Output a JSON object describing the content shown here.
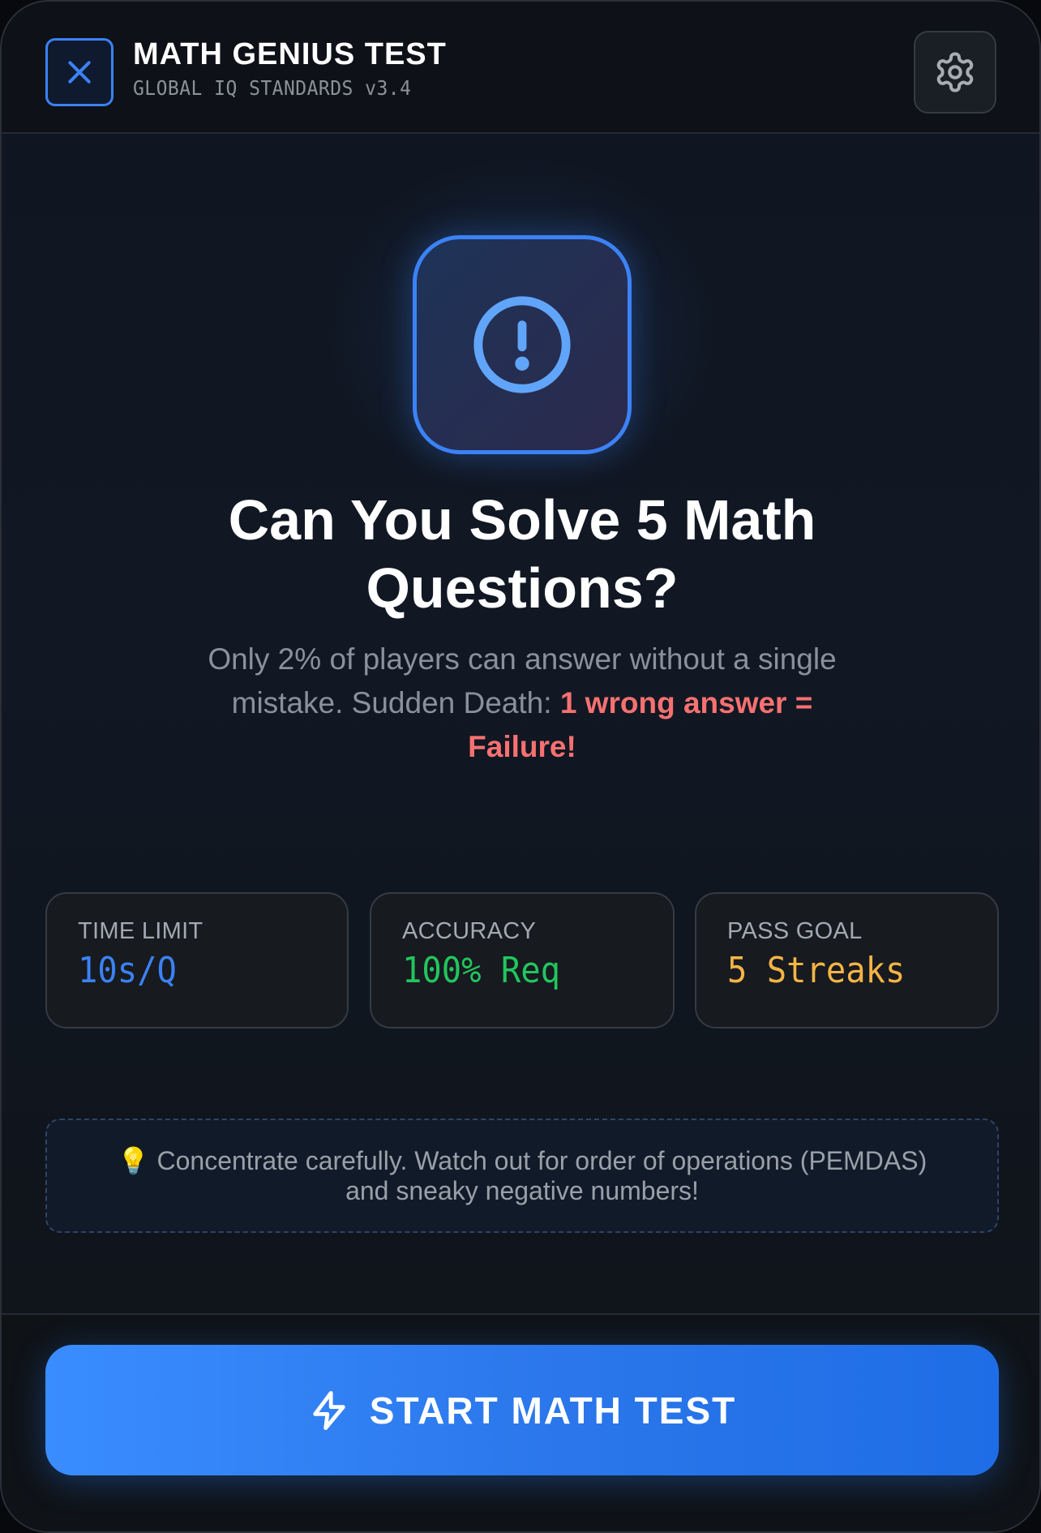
{
  "header": {
    "title": "MATH GENIUS TEST",
    "subtitle": "GLOBAL IQ STANDARDS v3.4",
    "close_icon": "close-icon",
    "settings_icon": "gear-icon"
  },
  "hero": {
    "icon": "alert-circle-icon",
    "headline": "Can You Solve 5 Math Questions?",
    "description_prefix": "Only 2% of players can answer without a single mistake. Sudden Death: ",
    "description_warning": "1 wrong answer = Failure!"
  },
  "stats": [
    {
      "label": "TIME LIMIT",
      "value": "10s/Q",
      "color": "#3b82f6"
    },
    {
      "label": "ACCURACY",
      "value": "100% Req",
      "color": "#22c55e"
    },
    {
      "label": "PASS GOAL",
      "value": "5 Streaks",
      "color": "#f5b446"
    }
  ],
  "tip": {
    "icon": "lightbulb-icon",
    "emoji": "💡",
    "text": "Concentrate carefully. Watch out for order of operations (PEMDAS) and sneaky negative numbers!"
  },
  "footer": {
    "start_label": "START MATH TEST",
    "start_icon": "lightning-icon"
  },
  "colors": {
    "accent": "#3b82f6",
    "danger": "#f87171",
    "success": "#22c55e",
    "warning": "#f5b446"
  }
}
